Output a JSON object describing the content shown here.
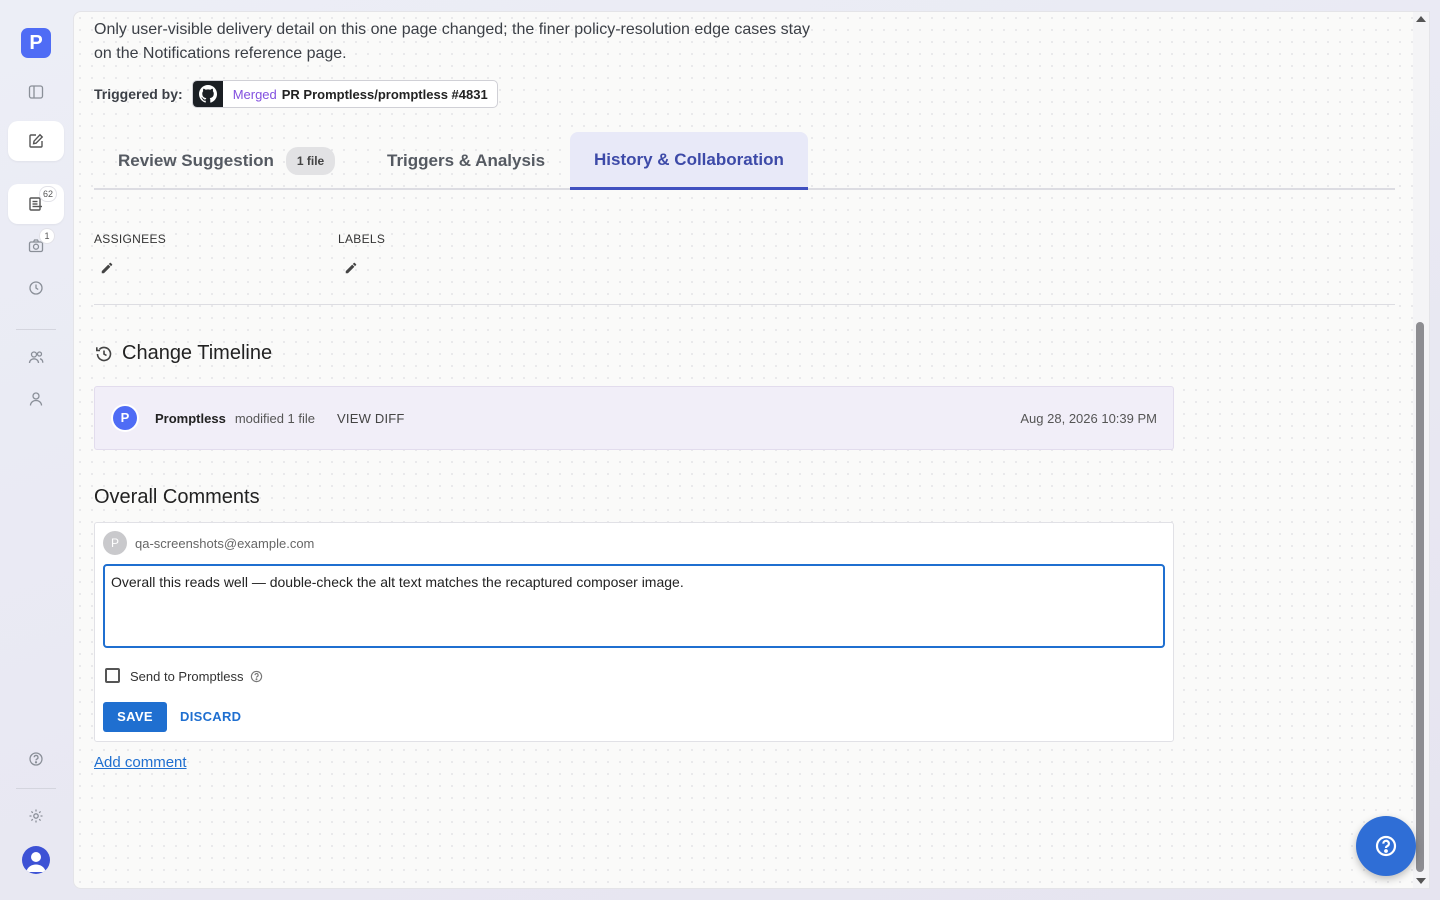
{
  "sidebar": {
    "logo_letter": "P",
    "badges": {
      "suggestions": "62",
      "screenshots": "1"
    }
  },
  "description": "Only user-visible delivery detail on this one page changed; the finer policy-resolution edge cases stay on the Notifications reference page.",
  "trigger": {
    "label": "Triggered by:",
    "status": "Merged",
    "pr_text": "PR Promptless/promptless #4831"
  },
  "tabs": [
    {
      "label": "Review Suggestion",
      "badge": "1 file"
    },
    {
      "label": "Triggers & Analysis"
    },
    {
      "label": "History & Collaboration",
      "active": true
    }
  ],
  "meta": {
    "assignees_label": "ASSIGNEES",
    "labels_label": "LABELS"
  },
  "timeline": {
    "title": "Change Timeline",
    "entries": [
      {
        "avatar": "P",
        "name": "Promptless",
        "action": "modified 1 file",
        "link": "VIEW DIFF",
        "date": "Aug 28, 2026 10:39 PM"
      }
    ]
  },
  "comments": {
    "title": "Overall Comments",
    "avatar": "P",
    "email": "qa-screenshots@example.com",
    "draft": "Overall this reads well — double-check the alt text matches the recaptured composer image.",
    "send_label": "Send to Promptless",
    "save_label": "SAVE",
    "discard_label": "DISCARD",
    "add_comment": "Add comment"
  },
  "colors": {
    "accent": "#1f6fd0",
    "brand": "#4f6cf5",
    "merged": "#8250df",
    "active_tab": "#3d4aa8"
  }
}
